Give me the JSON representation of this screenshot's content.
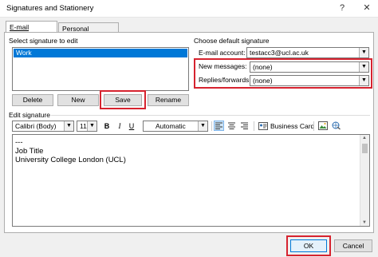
{
  "window": {
    "title": "Signatures and Stationery",
    "help_glyph": "?",
    "close_glyph": "✕"
  },
  "tabs": [
    {
      "label": "E-mail Signature",
      "active": true
    },
    {
      "label": "Personal Stationery",
      "active": false
    }
  ],
  "select_sig": {
    "label": "Select signature to edit",
    "items": [
      "Work"
    ],
    "selected": "Work"
  },
  "sig_buttons": {
    "delete": "Delete",
    "new": "New",
    "save": "Save",
    "rename": "Rename"
  },
  "defaults": {
    "heading": "Choose default signature",
    "account_label": "E-mail account:",
    "account_value": "testacc3@ucl.ac.uk",
    "new_messages_label": "New messages:",
    "new_messages_value": "(none)",
    "replies_label": "Replies/forwards:",
    "replies_value": "(none)"
  },
  "editor": {
    "label": "Edit signature",
    "font": "Calibri (Body)",
    "size": "11",
    "bold": "B",
    "italic": "I",
    "underline": "U",
    "color": "Automatic",
    "business_card": "Business Card",
    "lines": [
      "---",
      "Job Title",
      "University College London (UCL)"
    ]
  },
  "footer": {
    "ok": "OK",
    "cancel": "Cancel"
  },
  "colors": {
    "highlight": "#d6232f",
    "selection": "#0078d7"
  }
}
